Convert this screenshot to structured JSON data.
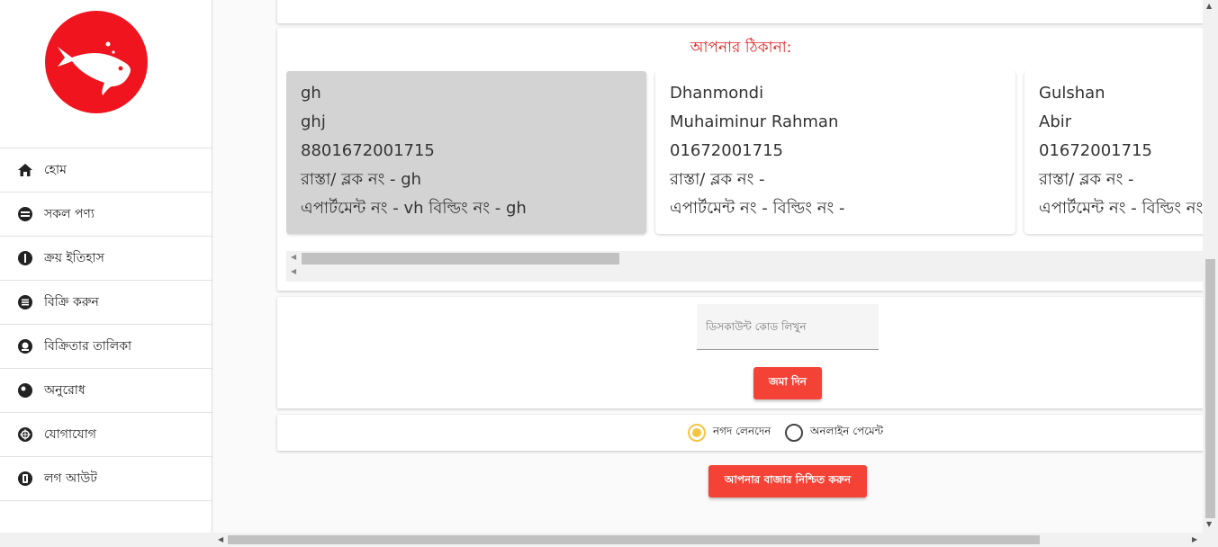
{
  "sidebar": {
    "items": [
      {
        "label": "হোম",
        "icon": "home-icon"
      },
      {
        "label": "সকল পণ্য",
        "icon": "products-icon"
      },
      {
        "label": "ক্রয় ইতিহাস",
        "icon": "history-icon"
      },
      {
        "label": "বিক্রি করুন",
        "icon": "list-icon"
      },
      {
        "label": "বিক্রিতার তালিকা",
        "icon": "seller-icon"
      },
      {
        "label": "অনুরোধ",
        "icon": "request-icon"
      },
      {
        "label": "যোগাযোগ",
        "icon": "contact-icon"
      },
      {
        "label": "লগ আউট",
        "icon": "logout-icon"
      }
    ]
  },
  "address_section": {
    "title": "আপনার ঠিকানা:",
    "addresses": [
      {
        "area": "gh",
        "name": "ghj",
        "phone": "8801672001715",
        "road": "রাস্তা/ ব্লক নং - gh",
        "apartment": "এপার্টমেন্ট নং - vh বিল্ডিং নং - gh",
        "selected": true
      },
      {
        "area": "Dhanmondi",
        "name": "Muhaiminur Rahman",
        "phone": "01672001715",
        "road": "রাস্তা/ ব্লক নং -",
        "apartment": "এপার্টমেন্ট নং - বিল্ডিং নং -",
        "selected": false
      },
      {
        "area": "Gulshan",
        "name": "Abir",
        "phone": "01672001715",
        "road": "রাস্তা/ ব্লক নং -",
        "apartment": "এপার্টমেন্ট নং - বিল্ডিং নং -",
        "selected": false
      }
    ]
  },
  "discount": {
    "placeholder": "ডিসকাউন্ট কোড লিখুন",
    "submit_label": "জমা দিন"
  },
  "payment": {
    "cash_label": "নগদ লেনদেন",
    "online_label": "অনলাইন পেমেন্ট",
    "selected": "cash"
  },
  "confirm_label": "আপনার বাজার নিশ্চিত করুন",
  "colors": {
    "accent": "#f44336",
    "logo": "#f0141e",
    "title": "#e22222",
    "radio": "#f5c542"
  }
}
